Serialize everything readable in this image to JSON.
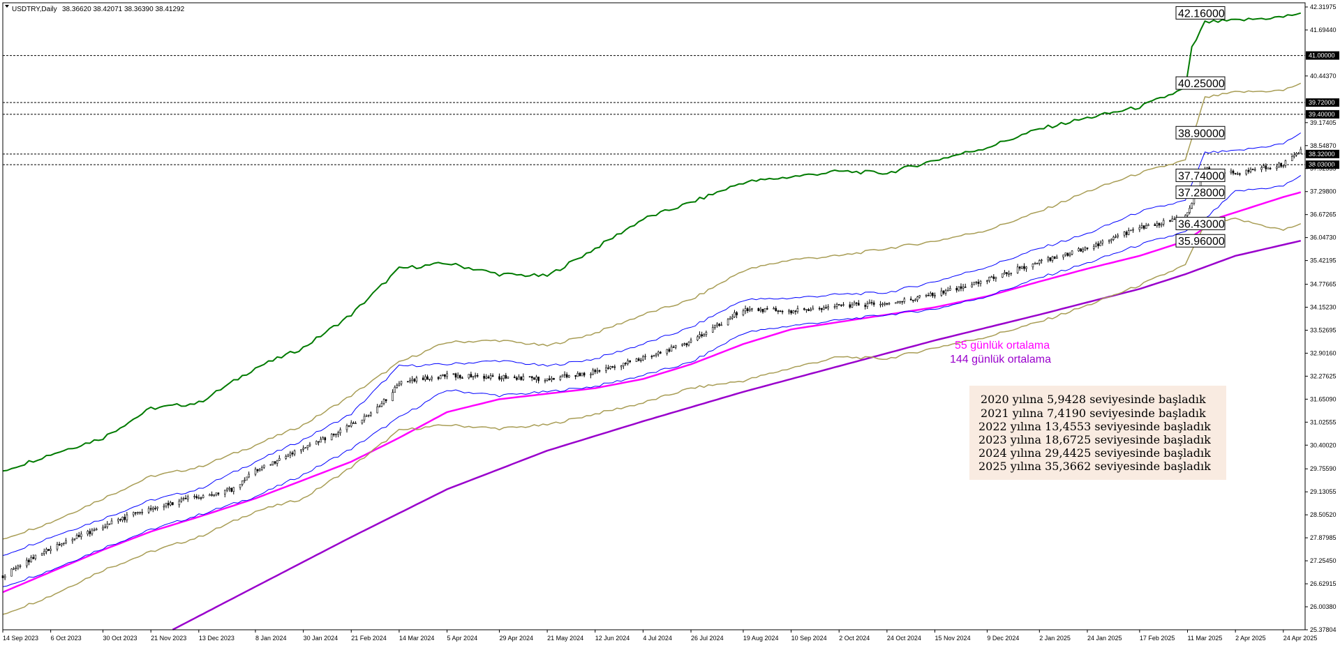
{
  "header": {
    "symbol": "USDTRY,Daily",
    "ohlc": "38.36620 38.42071 38.36390 38.41292"
  },
  "colors": {
    "background": "#ffffff",
    "candle": "#000000",
    "ma55": "#ff00ff",
    "ma144": "#9900cc",
    "band_inner": "#0000ff",
    "band_mid": "#a89d55",
    "band_outer": "#007a00",
    "level_line": "#000000",
    "note_bg": "#f9ebe1"
  },
  "chart_data": {
    "type": "candlestick",
    "title": "USDTRY,Daily",
    "ohlc_last": [
      38.3662,
      38.42071,
      38.3639,
      38.41292
    ],
    "ylim": [
      25.37804,
      42.31975
    ],
    "y_ticks": [
      "42.31975",
      "41.69440",
      "40.44370",
      "39.17405",
      "38.54870",
      "37.92335",
      "37.29800",
      "36.67265",
      "36.04730",
      "35.42195",
      "34.77665",
      "34.15230",
      "33.52695",
      "32.90160",
      "32.27625",
      "31.65090",
      "31.02555",
      "30.40020",
      "29.75590",
      "29.13055",
      "28.50520",
      "27.87985",
      "27.25450",
      "26.62915",
      "26.00380",
      "25.37804"
    ],
    "x_ticks": [
      "14 Sep 2023",
      "6 Oct 2023",
      "30 Oct 2023",
      "21 Nov 2023",
      "13 Dec 2023",
      "8 Jan 2024",
      "30 Jan 2024",
      "21 Feb 2024",
      "14 Mar 2024",
      "5 Apr 2024",
      "29 Apr 2024",
      "21 May 2024",
      "12 Jun 2024",
      "4 Jul 2024",
      "26 Jul 2024",
      "19 Aug 2024",
      "10 Sep 2024",
      "2 Oct 2024",
      "24 Oct 2024",
      "15 Nov 2024",
      "9 Dec 2024",
      "2 Jan 2025",
      "24 Jan 2025",
      "17 Feb 2025",
      "11 Mar 2025",
      "2 Apr 2025",
      "24 Apr 2025"
    ],
    "x_range": [
      "2023-09-14",
      "2025-05-04"
    ],
    "horizontal_levels": [
      {
        "value": 41.0,
        "label": "41.00000"
      },
      {
        "value": 39.72,
        "label": "39.72000"
      },
      {
        "value": 39.4,
        "label": "39.40000"
      },
      {
        "value": 38.32,
        "label": "38.32000"
      },
      {
        "value": 38.03,
        "label": "38.03000"
      }
    ],
    "right_labels": [
      {
        "value": 42.16,
        "label": "42.16000"
      },
      {
        "value": 40.25,
        "label": "40.25000"
      },
      {
        "value": 38.9,
        "label": "38.90000"
      },
      {
        "value": 37.74,
        "label": "37.74000"
      },
      {
        "value": 37.28,
        "label": "37.28000"
      },
      {
        "value": 36.43,
        "label": "36.43000"
      },
      {
        "value": 35.96,
        "label": "35.96000"
      }
    ],
    "series": [
      {
        "key": "price",
        "points": [
          [
            "2023-09-14",
            26.85
          ],
          [
            "2023-10-06",
            27.6
          ],
          [
            "2023-10-30",
            28.2
          ],
          [
            "2023-11-21",
            28.7
          ],
          [
            "2023-12-13",
            29.0
          ],
          [
            "2023-12-29",
            29.2
          ],
          [
            "2024-01-08",
            29.7
          ],
          [
            "2024-01-30",
            30.3
          ],
          [
            "2024-02-21",
            30.95
          ],
          [
            "2024-03-05",
            31.45
          ],
          [
            "2024-03-14",
            32.1
          ],
          [
            "2024-04-05",
            32.3
          ],
          [
            "2024-04-29",
            32.25
          ],
          [
            "2024-05-21",
            32.2
          ],
          [
            "2024-06-12",
            32.4
          ],
          [
            "2024-07-04",
            32.75
          ],
          [
            "2024-07-26",
            33.2
          ],
          [
            "2024-08-19",
            34.1
          ],
          [
            "2024-09-10",
            34.05
          ],
          [
            "2024-10-02",
            34.2
          ],
          [
            "2024-10-24",
            34.25
          ],
          [
            "2024-11-15",
            34.5
          ],
          [
            "2024-12-09",
            34.9
          ],
          [
            "2025-01-02",
            35.4
          ],
          [
            "2025-01-24",
            35.75
          ],
          [
            "2025-02-17",
            36.3
          ],
          [
            "2025-03-10",
            36.6
          ],
          [
            "2025-03-11",
            36.75
          ],
          [
            "2025-03-19",
            37.9
          ],
          [
            "2025-04-02",
            37.8
          ],
          [
            "2025-04-24",
            38.05
          ],
          [
            "2025-05-02",
            38.41
          ]
        ]
      },
      {
        "key": "ma55",
        "name": "55 günlük ortalama",
        "points": [
          [
            "2023-09-14",
            26.4
          ],
          [
            "2023-10-06",
            26.95
          ],
          [
            "2023-10-30",
            27.55
          ],
          [
            "2023-11-21",
            28.05
          ],
          [
            "2023-12-13",
            28.45
          ],
          [
            "2024-01-08",
            28.95
          ],
          [
            "2024-01-30",
            29.45
          ],
          [
            "2024-02-21",
            29.95
          ],
          [
            "2024-03-14",
            30.6
          ],
          [
            "2024-04-05",
            31.3
          ],
          [
            "2024-04-29",
            31.65
          ],
          [
            "2024-05-21",
            31.8
          ],
          [
            "2024-06-12",
            31.95
          ],
          [
            "2024-07-04",
            32.2
          ],
          [
            "2024-07-26",
            32.6
          ],
          [
            "2024-08-19",
            33.15
          ],
          [
            "2024-09-10",
            33.55
          ],
          [
            "2024-10-02",
            33.75
          ],
          [
            "2024-10-24",
            33.95
          ],
          [
            "2024-11-15",
            34.15
          ],
          [
            "2024-12-09",
            34.45
          ],
          [
            "2025-01-02",
            34.85
          ],
          [
            "2025-01-24",
            35.2
          ],
          [
            "2025-02-17",
            35.55
          ],
          [
            "2025-03-10",
            35.95
          ],
          [
            "2025-03-26",
            36.6
          ],
          [
            "2025-04-24",
            37.15
          ],
          [
            "2025-05-02",
            37.28
          ]
        ]
      },
      {
        "key": "ma144",
        "name": "144 günlük ortalama",
        "points": [
          [
            "2023-12-01",
            25.38
          ],
          [
            "2024-01-08",
            26.55
          ],
          [
            "2024-02-21",
            27.9
          ],
          [
            "2024-04-05",
            29.2
          ],
          [
            "2024-05-21",
            30.25
          ],
          [
            "2024-07-04",
            31.05
          ],
          [
            "2024-08-19",
            31.85
          ],
          [
            "2024-10-02",
            32.55
          ],
          [
            "2024-11-15",
            33.25
          ],
          [
            "2025-01-02",
            33.95
          ],
          [
            "2025-02-17",
            34.65
          ],
          [
            "2025-03-10",
            35.05
          ],
          [
            "2025-04-02",
            35.55
          ],
          [
            "2025-05-02",
            35.96
          ]
        ]
      },
      {
        "key": "band1_up",
        "points": [
          [
            "2023-09-14",
            27.4
          ],
          [
            "2023-10-06",
            27.9
          ],
          [
            "2023-10-30",
            28.4
          ],
          [
            "2023-11-21",
            28.9
          ],
          [
            "2023-12-13",
            29.2
          ],
          [
            "2024-01-08",
            29.95
          ],
          [
            "2024-01-30",
            30.55
          ],
          [
            "2024-02-21",
            31.25
          ],
          [
            "2024-03-14",
            32.55
          ],
          [
            "2024-04-05",
            32.6
          ],
          [
            "2024-04-29",
            32.7
          ],
          [
            "2024-05-21",
            32.55
          ],
          [
            "2024-06-12",
            32.75
          ],
          [
            "2024-07-04",
            33.15
          ],
          [
            "2024-07-26",
            33.6
          ],
          [
            "2024-08-19",
            34.35
          ],
          [
            "2024-09-10",
            34.4
          ],
          [
            "2024-10-02",
            34.5
          ],
          [
            "2024-10-24",
            34.55
          ],
          [
            "2024-11-15",
            34.85
          ],
          [
            "2024-12-09",
            35.25
          ],
          [
            "2025-01-02",
            35.75
          ],
          [
            "2025-01-24",
            36.15
          ],
          [
            "2025-02-17",
            36.75
          ],
          [
            "2025-03-10",
            37.05
          ],
          [
            "2025-03-19",
            38.35
          ],
          [
            "2025-04-02",
            38.4
          ],
          [
            "2025-04-24",
            38.6
          ],
          [
            "2025-05-02",
            38.9
          ]
        ]
      },
      {
        "key": "band1_dn",
        "points": [
          [
            "2023-09-14",
            26.55
          ],
          [
            "2023-10-06",
            27.0
          ],
          [
            "2023-10-30",
            27.6
          ],
          [
            "2023-11-21",
            28.1
          ],
          [
            "2023-12-13",
            28.5
          ],
          [
            "2024-01-08",
            29.0
          ],
          [
            "2024-01-30",
            29.6
          ],
          [
            "2024-02-21",
            30.3
          ],
          [
            "2024-03-14",
            31.15
          ],
          [
            "2024-04-05",
            31.9
          ],
          [
            "2024-04-29",
            31.75
          ],
          [
            "2024-05-21",
            31.85
          ],
          [
            "2024-06-12",
            32.0
          ],
          [
            "2024-07-04",
            32.3
          ],
          [
            "2024-07-26",
            32.65
          ],
          [
            "2024-08-19",
            33.45
          ],
          [
            "2024-09-10",
            33.65
          ],
          [
            "2024-10-02",
            33.8
          ],
          [
            "2024-10-24",
            33.95
          ],
          [
            "2024-11-15",
            34.1
          ],
          [
            "2024-12-09",
            34.45
          ],
          [
            "2025-01-02",
            34.95
          ],
          [
            "2025-01-24",
            35.35
          ],
          [
            "2025-02-17",
            35.85
          ],
          [
            "2025-03-10",
            36.2
          ],
          [
            "2025-03-19",
            36.55
          ],
          [
            "2025-04-02",
            37.3
          ],
          [
            "2025-04-24",
            37.45
          ],
          [
            "2025-05-02",
            37.74
          ]
        ]
      },
      {
        "key": "band2_up",
        "points": [
          [
            "2023-09-14",
            27.85
          ],
          [
            "2023-10-06",
            28.3
          ],
          [
            "2023-10-30",
            28.95
          ],
          [
            "2023-11-21",
            29.55
          ],
          [
            "2023-12-13",
            29.8
          ],
          [
            "2024-01-08",
            30.4
          ],
          [
            "2024-01-30",
            30.95
          ],
          [
            "2024-02-21",
            31.75
          ],
          [
            "2024-03-14",
            32.65
          ],
          [
            "2024-04-05",
            33.2
          ],
          [
            "2024-04-29",
            33.25
          ],
          [
            "2024-05-21",
            33.1
          ],
          [
            "2024-06-12",
            33.45
          ],
          [
            "2024-07-04",
            33.95
          ],
          [
            "2024-07-26",
            34.35
          ],
          [
            "2024-08-19",
            35.15
          ],
          [
            "2024-09-10",
            35.45
          ],
          [
            "2024-10-02",
            35.55
          ],
          [
            "2024-10-24",
            35.75
          ],
          [
            "2024-11-15",
            35.95
          ],
          [
            "2024-12-09",
            36.25
          ],
          [
            "2025-01-02",
            36.75
          ],
          [
            "2025-01-24",
            37.3
          ],
          [
            "2025-02-17",
            37.8
          ],
          [
            "2025-03-10",
            38.15
          ],
          [
            "2025-03-19",
            39.85
          ],
          [
            "2025-04-02",
            40.0
          ],
          [
            "2025-04-24",
            40.05
          ],
          [
            "2025-05-02",
            40.25
          ]
        ]
      },
      {
        "key": "band2_dn",
        "points": [
          [
            "2023-09-14",
            25.8
          ],
          [
            "2023-10-06",
            26.3
          ],
          [
            "2023-10-30",
            27.0
          ],
          [
            "2023-11-21",
            27.5
          ],
          [
            "2023-12-13",
            27.9
          ],
          [
            "2024-01-08",
            28.6
          ],
          [
            "2024-01-30",
            28.95
          ],
          [
            "2024-02-21",
            29.8
          ],
          [
            "2024-03-14",
            30.8
          ],
          [
            "2024-04-05",
            30.95
          ],
          [
            "2024-04-29",
            30.85
          ],
          [
            "2024-05-21",
            30.95
          ],
          [
            "2024-06-12",
            31.25
          ],
          [
            "2024-07-04",
            31.55
          ],
          [
            "2024-07-26",
            31.95
          ],
          [
            "2024-08-19",
            32.15
          ],
          [
            "2024-09-10",
            32.5
          ],
          [
            "2024-10-02",
            32.8
          ],
          [
            "2024-10-24",
            32.75
          ],
          [
            "2024-11-15",
            33.05
          ],
          [
            "2024-12-09",
            33.35
          ],
          [
            "2025-01-02",
            33.75
          ],
          [
            "2025-01-24",
            34.2
          ],
          [
            "2025-02-17",
            34.75
          ],
          [
            "2025-03-10",
            35.3
          ],
          [
            "2025-03-19",
            36.4
          ],
          [
            "2025-04-02",
            36.55
          ],
          [
            "2025-04-24",
            36.25
          ],
          [
            "2025-05-02",
            36.43
          ]
        ]
      },
      {
        "key": "band3_up",
        "points": [
          [
            "2023-09-14",
            29.7
          ],
          [
            "2023-10-06",
            30.15
          ],
          [
            "2023-10-30",
            30.6
          ],
          [
            "2023-11-21",
            31.4
          ],
          [
            "2023-12-13",
            31.55
          ],
          [
            "2024-01-08",
            32.5
          ],
          [
            "2024-01-30",
            33.05
          ],
          [
            "2024-02-21",
            33.95
          ],
          [
            "2024-03-14",
            35.2
          ],
          [
            "2024-04-05",
            35.35
          ],
          [
            "2024-04-29",
            35.05
          ],
          [
            "2024-05-21",
            35.0
          ],
          [
            "2024-06-12",
            35.75
          ],
          [
            "2024-07-04",
            36.55
          ],
          [
            "2024-07-26",
            37.0
          ],
          [
            "2024-08-19",
            37.55
          ],
          [
            "2024-09-10",
            37.7
          ],
          [
            "2024-10-02",
            37.85
          ],
          [
            "2024-10-24",
            37.8
          ],
          [
            "2024-11-15",
            38.15
          ],
          [
            "2024-12-09",
            38.5
          ],
          [
            "2025-01-02",
            39.0
          ],
          [
            "2025-01-24",
            39.3
          ],
          [
            "2025-02-17",
            39.6
          ],
          [
            "2025-03-10",
            40.1
          ],
          [
            "2025-03-13",
            41.2
          ],
          [
            "2025-03-19",
            41.9
          ],
          [
            "2025-04-02",
            41.95
          ],
          [
            "2025-04-24",
            42.05
          ],
          [
            "2025-05-02",
            42.16
          ]
        ]
      }
    ],
    "annotations": {
      "ma_labels": [
        "55 günlük ortalama",
        "144 günlük ortalama"
      ],
      "note_lines": [
        "2020 yılına 5,9428 seviyesinde başladık",
        "2021 yılına 7,4190 seviyesinde başladık",
        "2022 yılına 13,4553 seviyesinde başladık",
        "2023 yılına 18,6725 seviyesinde başladık",
        "2024 yılına 29,4425 seviyesinde başladık",
        "2025  yılına 35,3662 seviyesinde başladık"
      ]
    }
  }
}
